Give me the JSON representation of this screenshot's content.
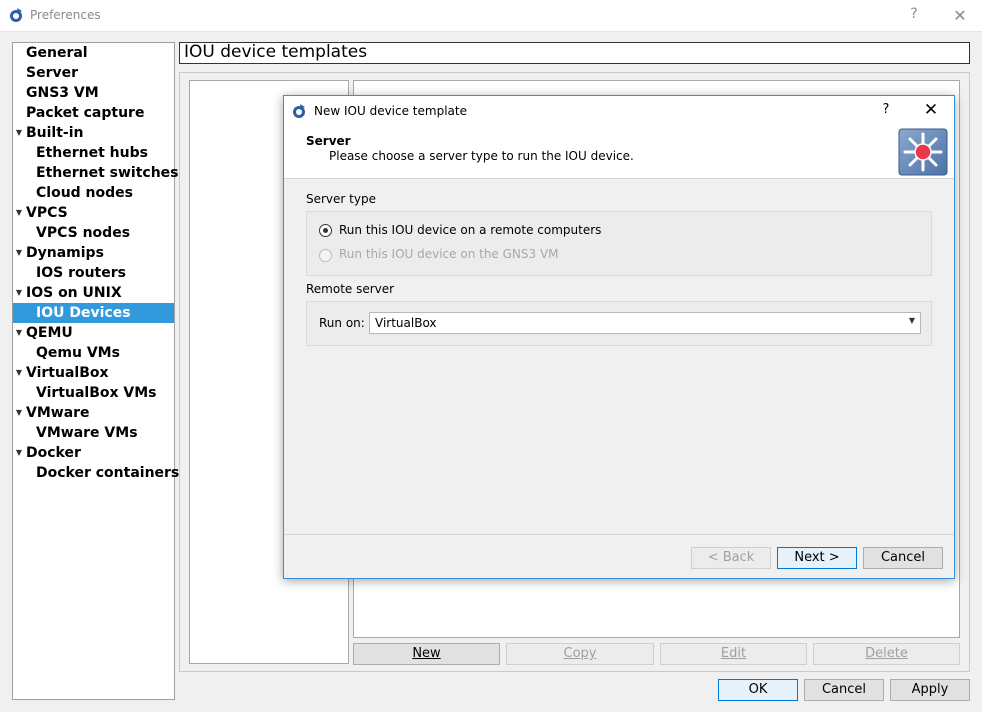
{
  "window": {
    "title": "Preferences",
    "help_label": "?",
    "close_label": "✕"
  },
  "nav": {
    "items": [
      {
        "label": "General",
        "indent": 0,
        "arrow": false
      },
      {
        "label": "Server",
        "indent": 0,
        "arrow": false
      },
      {
        "label": "GNS3 VM",
        "indent": 0,
        "arrow": false
      },
      {
        "label": "Packet capture",
        "indent": 0,
        "arrow": false
      },
      {
        "label": "Built-in",
        "indent": 0,
        "arrow": true
      },
      {
        "label": "Ethernet hubs",
        "indent": 1,
        "arrow": false
      },
      {
        "label": "Ethernet switches",
        "indent": 1,
        "arrow": false
      },
      {
        "label": "Cloud nodes",
        "indent": 1,
        "arrow": false
      },
      {
        "label": "VPCS",
        "indent": 0,
        "arrow": true
      },
      {
        "label": "VPCS nodes",
        "indent": 1,
        "arrow": false
      },
      {
        "label": "Dynamips",
        "indent": 0,
        "arrow": true
      },
      {
        "label": "IOS routers",
        "indent": 1,
        "arrow": false
      },
      {
        "label": "IOS on UNIX",
        "indent": 0,
        "arrow": true
      },
      {
        "label": "IOU Devices",
        "indent": 1,
        "arrow": false,
        "selected": true
      },
      {
        "label": "QEMU",
        "indent": 0,
        "arrow": true
      },
      {
        "label": "Qemu VMs",
        "indent": 1,
        "arrow": false
      },
      {
        "label": "VirtualBox",
        "indent": 0,
        "arrow": true
      },
      {
        "label": "VirtualBox VMs",
        "indent": 1,
        "arrow": false
      },
      {
        "label": "VMware",
        "indent": 0,
        "arrow": true
      },
      {
        "label": "VMware VMs",
        "indent": 1,
        "arrow": false
      },
      {
        "label": "Docker",
        "indent": 0,
        "arrow": true
      },
      {
        "label": "Docker containers",
        "indent": 1,
        "arrow": false
      }
    ]
  },
  "page": {
    "heading": "IOU device templates",
    "buttons": {
      "new": "New",
      "copy": "Copy",
      "edit": "Edit",
      "delete": "Delete"
    }
  },
  "footer": {
    "ok": "OK",
    "cancel": "Cancel",
    "apply": "Apply"
  },
  "dialog": {
    "title": "New IOU device template",
    "help_label": "?",
    "close_label": "✕",
    "heading": "Server",
    "subtitle": "Please choose a server type to run the IOU device.",
    "server_type_label": "Server type",
    "radio_remote": "Run this IOU device on a remote computers",
    "radio_vm": "Run this IOU device on the GNS3 VM",
    "remote_server_label": "Remote server",
    "run_on_label": "Run on:",
    "run_on_value": "VirtualBox",
    "back": "< Back",
    "next": "Next >",
    "cancel": "Cancel"
  }
}
